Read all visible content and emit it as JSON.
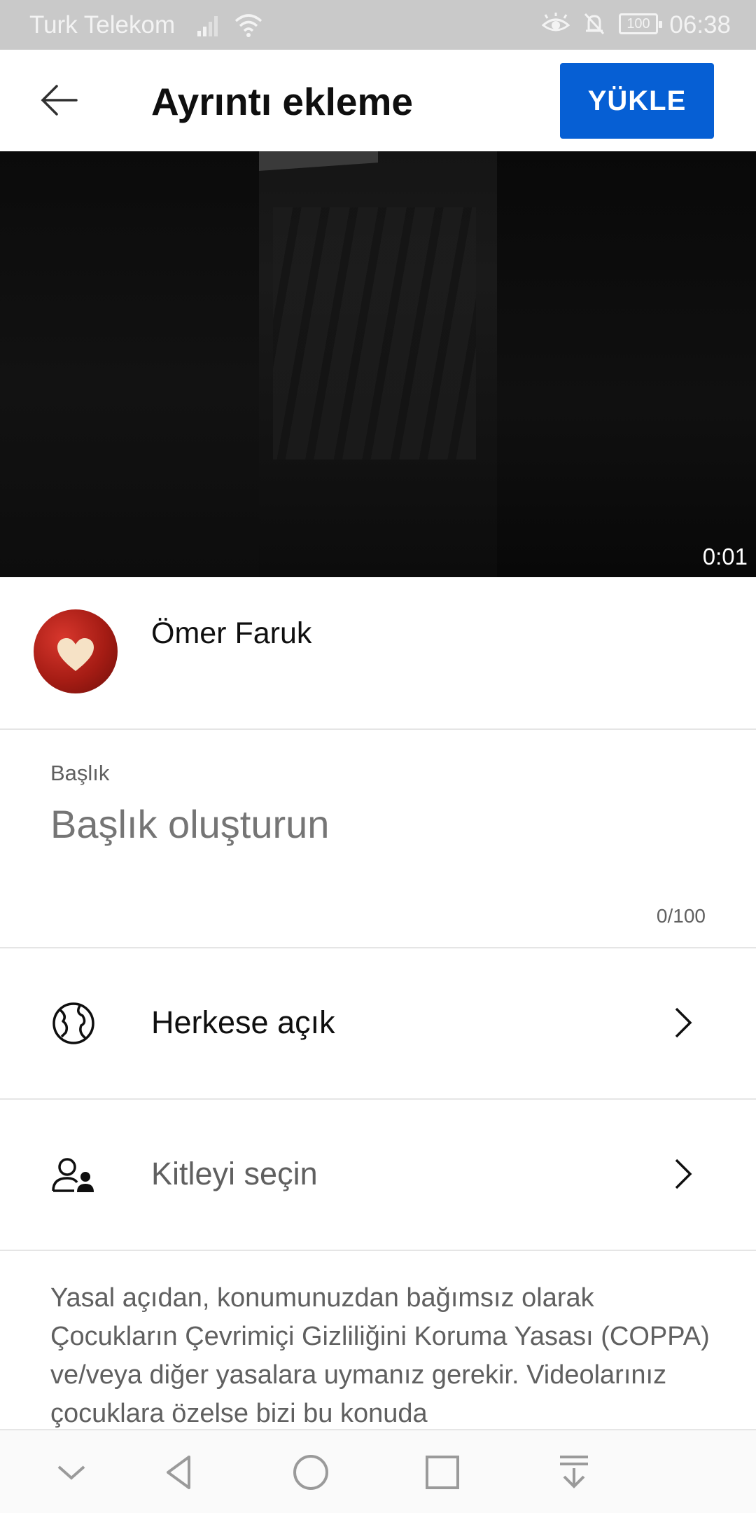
{
  "status_bar": {
    "carrier": "Turk Telekom",
    "time": "06:38",
    "battery": "100"
  },
  "header": {
    "title": "Ayrıntı ekleme",
    "upload_label": "YÜKLE"
  },
  "video": {
    "duration": "0:01"
  },
  "channel": {
    "name": "Ömer Faruk"
  },
  "title_field": {
    "label": "Başlık",
    "placeholder": "Başlık oluşturun",
    "counter": "0/100"
  },
  "options": [
    {
      "label": "Herkese açık",
      "icon": "globe-icon"
    },
    {
      "label": "Kitleyi seçin",
      "icon": "audience-icon"
    }
  ],
  "legal_text": "Yasal açıdan, konumunuzdan bağımsız olarak Çocukların Çevrimiçi Gizliliğini Koruma Yasası (COPPA) ve/veya diğer yasalara uymanız gerekir. Videolarınız çocuklara özelse bizi bu konuda",
  "colors": {
    "accent": "#065fd4",
    "status_bar": "#c9c9c9"
  }
}
